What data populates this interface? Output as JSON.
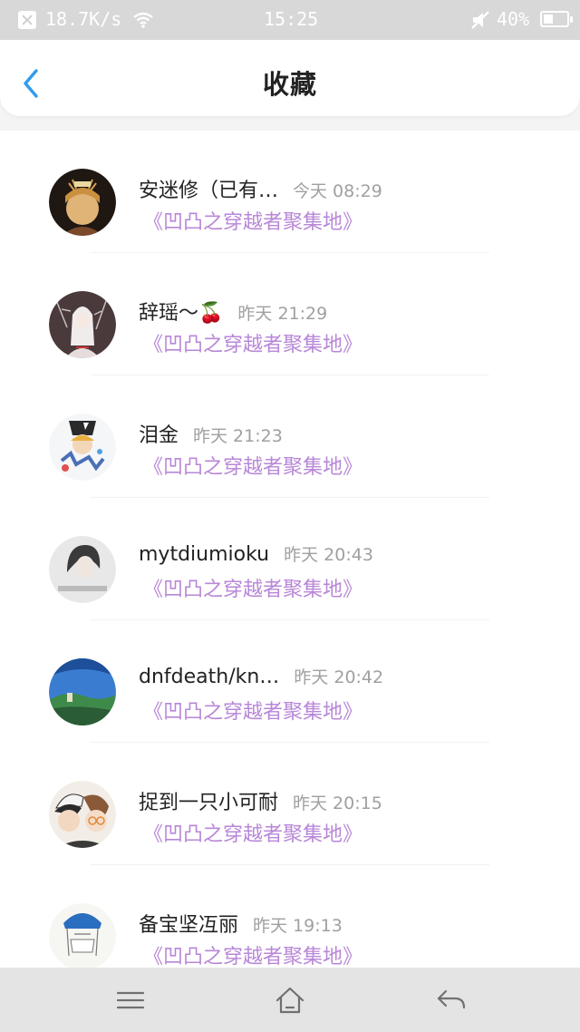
{
  "status_bar": {
    "speed": "18.7K/s",
    "time": "15:25",
    "battery": "40%",
    "icons": [
      "close-icon",
      "wifi-icon",
      "mute-icon",
      "battery-icon"
    ]
  },
  "header": {
    "title": "收藏",
    "back_icon": "chevron-left-icon",
    "accent_color": "#2f9bf0"
  },
  "items": [
    {
      "name": "安迷修（已有…",
      "time": "今天 08:29",
      "group": "《凹凸之穿越者聚集地》"
    },
    {
      "name": "辞瑶～🍒",
      "time": "昨天 21:29",
      "group": "《凹凸之穿越者聚集地》"
    },
    {
      "name": "泪金",
      "time": "昨天 21:23",
      "group": "《凹凸之穿越者聚集地》"
    },
    {
      "name": "mytdiumioku",
      "time": "昨天 20:43",
      "group": "《凹凸之穿越者聚集地》"
    },
    {
      "name": "dnfdeath/kn…",
      "time": "昨天 20:42",
      "group": "《凹凸之穿越者聚集地》"
    },
    {
      "name": "捉到一只小可耐",
      "time": "昨天 20:15",
      "group": "《凹凸之穿越者聚集地》"
    },
    {
      "name": "备宝坚冱丽",
      "time": "昨天 19:13",
      "group": "《凹凸之穿越者聚集地》"
    }
  ],
  "colors": {
    "group_text": "#b887d8",
    "name_text": "#222222",
    "time_text": "#a0a0a0"
  },
  "bottom_nav": [
    "menu-icon",
    "home-icon",
    "back-icon"
  ]
}
